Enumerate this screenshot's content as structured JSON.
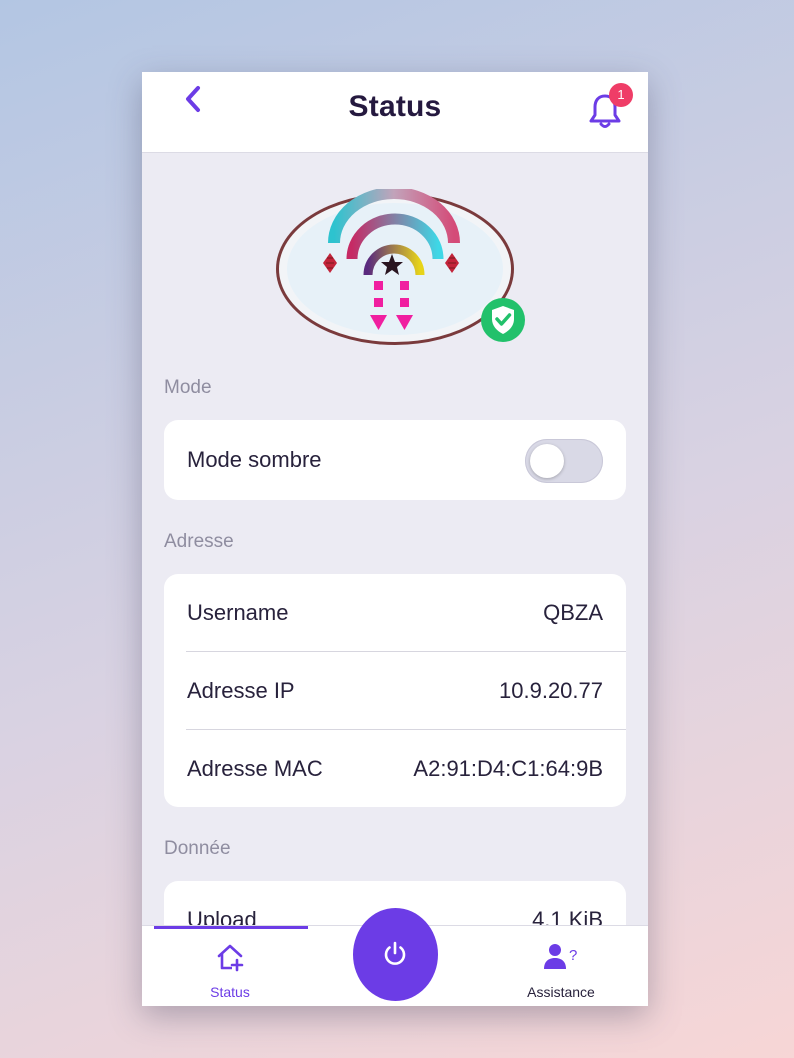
{
  "header": {
    "title": "Status",
    "notification_count": "1"
  },
  "sections": {
    "mode": {
      "title": "Mode",
      "dark_mode_label": "Mode sombre",
      "dark_mode_enabled": false
    },
    "address": {
      "title": "Adresse",
      "rows": [
        {
          "label": "Username",
          "value": "QBZA"
        },
        {
          "label": "Adresse IP",
          "value": "10.9.20.77"
        },
        {
          "label": "Adresse MAC",
          "value": "A2:91:D4:C1:64:9B"
        }
      ]
    },
    "data": {
      "title": "Donnée",
      "rows": [
        {
          "label": "Upload",
          "value": "4.1 KiB"
        }
      ]
    }
  },
  "nav": {
    "status_label": "Status",
    "assistance_label": "Assistance"
  },
  "colors": {
    "accent": "#6c3ce6",
    "badge": "#ef3d67",
    "verified": "#22c16b",
    "text": "#28223c",
    "section_label": "#8f8da0"
  },
  "icons": {
    "back": "chevron-left-icon",
    "notifications": "bell-icon",
    "verified": "shield-check-icon",
    "status_nav": "home-plus-icon",
    "assistance_nav": "user-question-icon",
    "power": "power-icon"
  }
}
